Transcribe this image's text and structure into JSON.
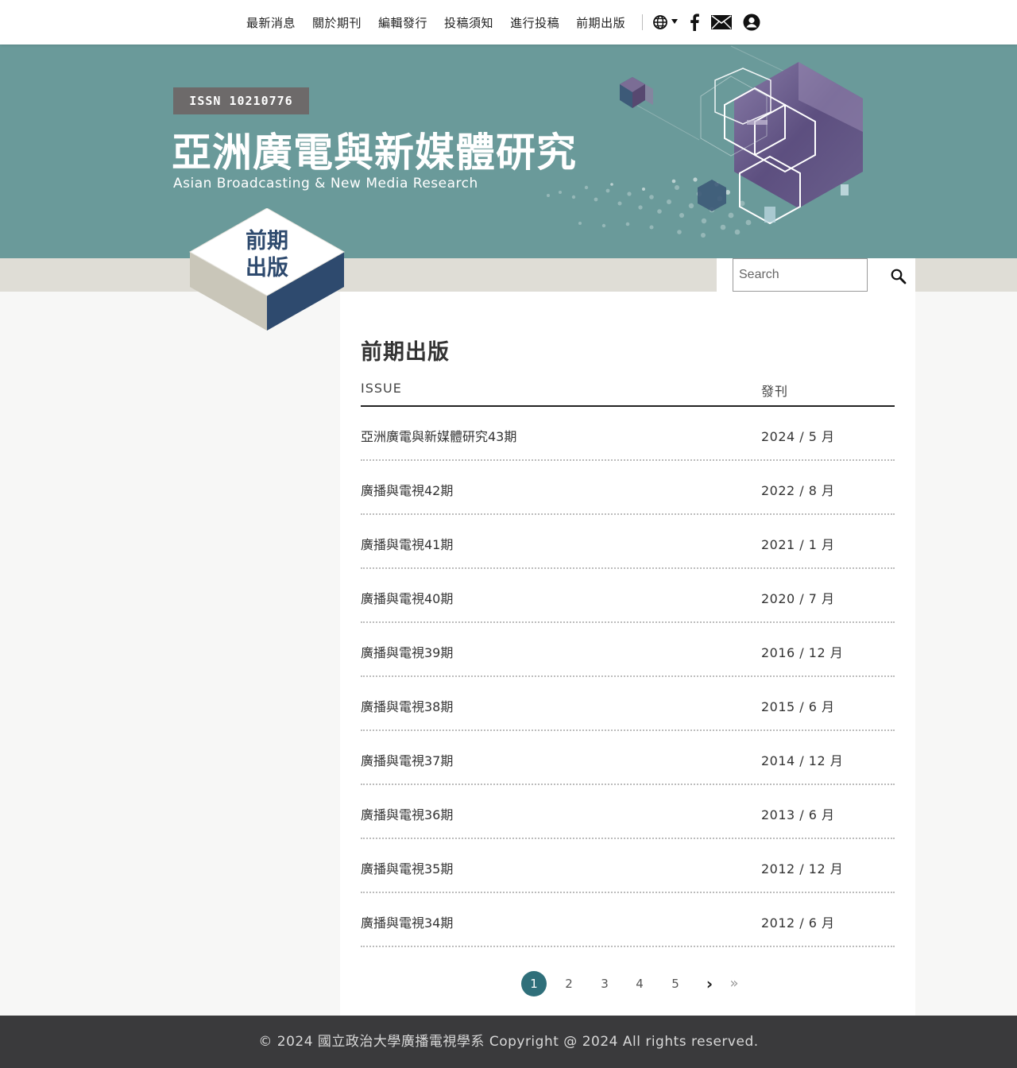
{
  "nav": {
    "items": [
      {
        "label": "最新消息"
      },
      {
        "label": "關於期刊"
      },
      {
        "label": "編輯發行"
      },
      {
        "label": "投稿須知"
      },
      {
        "label": "進行投稿"
      },
      {
        "label": "前期出版"
      }
    ],
    "icons": [
      "globe-language-icon",
      "facebook-icon",
      "mail-icon",
      "user-account-icon"
    ]
  },
  "banner": {
    "issn": "ISSN 10210776",
    "title_zh": "亞洲廣電與新媒體研究",
    "title_en": "Asian Broadcasting & New Media Research"
  },
  "badge": {
    "line1": "前期",
    "line2": "出版"
  },
  "search": {
    "placeholder": "Search",
    "icon": "search-icon"
  },
  "main": {
    "title": "前期出版",
    "columns": {
      "issue": "ISSUE",
      "date": "發刊"
    },
    "rows": [
      {
        "issue": "亞洲廣電與新媒體研究43期",
        "date": "2024 / 5 月"
      },
      {
        "issue": "廣播與電視42期",
        "date": "2022 / 8 月"
      },
      {
        "issue": "廣播與電視41期",
        "date": "2021 / 1 月"
      },
      {
        "issue": "廣播與電視40期",
        "date": "2020 / 7 月"
      },
      {
        "issue": "廣播與電視39期",
        "date": "2016 / 12 月"
      },
      {
        "issue": "廣播與電視38期",
        "date": "2015 / 6 月"
      },
      {
        "issue": "廣播與電視37期",
        "date": "2014 / 12 月"
      },
      {
        "issue": "廣播與電視36期",
        "date": "2013 / 6 月"
      },
      {
        "issue": "廣播與電視35期",
        "date": "2012 / 12 月"
      },
      {
        "issue": "廣播與電視34期",
        "date": "2012 / 6 月"
      }
    ]
  },
  "pagination": {
    "pages": [
      "1",
      "2",
      "3",
      "4",
      "5"
    ],
    "current": "1",
    "next": "›",
    "last": "»"
  },
  "footer": {
    "text": "© 2024 國立政治大學廣播電視學系 Copyright @ 2024 All rights reserved."
  },
  "colors": {
    "banner": "#6a9a9a",
    "band": "#dfddd6",
    "badge_blue": "#2e4a6e",
    "active_page": "#2f6f7a",
    "footer": "#3a3a3c"
  }
}
